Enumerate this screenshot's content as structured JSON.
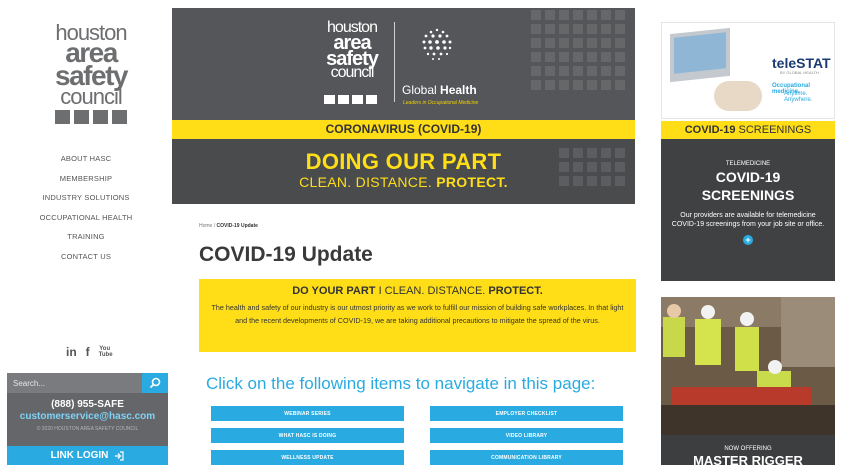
{
  "sidebar": {
    "logo": {
      "line1": "houston",
      "line2": "area",
      "line3": "safety",
      "line4": "council"
    },
    "nav": [
      "ABOUT HASC",
      "MEMBERSHIP",
      "INDUSTRY SOLUTIONS",
      "OCCUPATIONAL HEALTH",
      "TRAINING",
      "CONTACT US"
    ],
    "social": {
      "linkedin": "in",
      "facebook": "f",
      "youtube": "You Tube"
    },
    "search_placeholder": "Search...",
    "phone": "(888) 955-SAFE",
    "email": "customerservice@hasc.com",
    "copyright": "© 2020 HOUSTON AREA SAFETY COUNCIL",
    "login_label": "LINK LOGIN"
  },
  "hero": {
    "logo": {
      "line1": "houston",
      "line2": "area",
      "line3": "safety",
      "line4": "council"
    },
    "global_health": "Global",
    "global_health_bold": "Health",
    "global_health_sub": "Leaders in Occupational Medicine",
    "band": "CORONAVIRUS (COVID-19)",
    "headline": "DOING OUR PART",
    "subhead_plain": "CLEAN. DISTANCE.",
    "subhead_bold": "PROTECT."
  },
  "breadcrumb": {
    "home": "Home",
    "separator": "/",
    "current": "COVID-19 Update"
  },
  "page_title": "COVID-19 Update",
  "notice": {
    "head_bold": "DO YOUR PART",
    "head_mid": " I CLEAN. DISTANCE. ",
    "head_end": "PROTECT.",
    "body": "The health and safety of our industry is our utmost priority as we work to fulfill our mission of building safe workplaces. In that light and the recent developments of COVID-19, we are taking additional precautions to mitigate the spread of the virus."
  },
  "navigate_title": "Click on the following items to navigate in this page:",
  "nav_buttons_left": [
    "WEBINAR SERIES",
    "WHAT HASC IS DOING",
    "WELLNESS UPDATE"
  ],
  "nav_buttons_right": [
    "EMPLOYER CHECKLIST",
    "VIDEO LIBRARY",
    "COMMUNICATION LIBRARY"
  ],
  "right": {
    "telestat_logo": "teleSTAT",
    "telestat_by": "BY GLOBAL HEALTH",
    "telestat_tag1": "Occupational medicine.",
    "telestat_tag2": "Anytime. Anywhere.",
    "band_bold": "COVID-19",
    "band_plain": " SCREENINGS",
    "box_kicker": "TELEMEDICINE",
    "box_title1": "COVID-19",
    "box_title2": "SCREENINGS",
    "box_body": "Our providers are available for telemedicine COVID-19 screenings from your job site or office.",
    "box_plus": "+",
    "ad2_kicker": "NOW OFFERING",
    "ad2_title": "MASTER RIGGER"
  },
  "colors": {
    "accent_blue": "#29abe2",
    "accent_yellow": "#ffde17",
    "dark_gray": "#404143"
  }
}
